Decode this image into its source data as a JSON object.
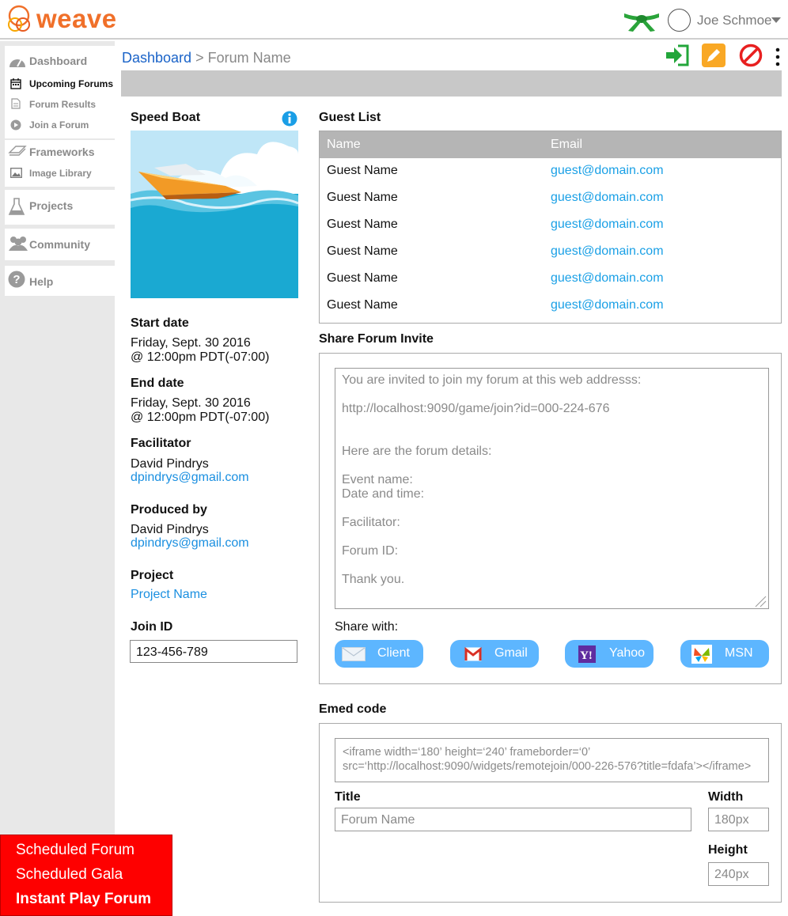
{
  "header": {
    "logo_text": "weave",
    "username": "Joe Schmoe"
  },
  "sidebar": {
    "dashboard": "Dashboard",
    "upcoming": "Upcoming Forums",
    "results": "Forum Results",
    "join": "Join a Forum",
    "frameworks": "Frameworks",
    "library": "Image Library",
    "projects": "Projects",
    "community": "Community",
    "help": "Help"
  },
  "breadcrumb": {
    "root": "Dashboard",
    "sep": " > ",
    "current": "Forum Name"
  },
  "forum": {
    "title": "Speed Boat",
    "start_label": "Start date",
    "start_date": "Friday, Sept. 30 2016",
    "start_time": "@ 12:00pm PDT(-07:00)",
    "end_label": "End date",
    "end_date": "Friday, Sept. 30 2016",
    "end_time": "@ 12:00pm PDT(-07:00)",
    "facilitator_label": "Facilitator",
    "facilitator_name": "David Pindrys",
    "facilitator_email": "dpindrys@gmail.com",
    "producer_label": "Produced by",
    "producer_name": "David Pindrys",
    "producer_email": "dpindrys@gmail.com",
    "project_label": "Project",
    "project_name": "Project Name",
    "join_label": "Join ID",
    "join_id": "123-456-789"
  },
  "guests": {
    "title": "Guest List",
    "col_name": "Name",
    "col_email": "Email",
    "rows": [
      {
        "name": "Guest Name",
        "email": "guest@domain.com"
      },
      {
        "name": "Guest Name",
        "email": "guest@domain.com"
      },
      {
        "name": "Guest Name",
        "email": "guest@domain.com"
      },
      {
        "name": "Guest Name",
        "email": "guest@domain.com"
      },
      {
        "name": "Guest Name",
        "email": "guest@domain.com"
      },
      {
        "name": "Guest Name",
        "email": "guest@domain.com"
      }
    ]
  },
  "share": {
    "title": "Share Forum Invite",
    "lines": [
      "You are invited to join my forum at this web addresss:",
      "http://localhost:9090/game/join?id=000-224-676",
      "Here are the forum details:",
      "Event name:",
      "Date and time:",
      "Facilitator:",
      "Forum ID:",
      "Thank you."
    ],
    "share_with": "Share with:",
    "buttons": [
      "Client",
      "Gmail",
      "Yahoo",
      "MSN"
    ]
  },
  "embed": {
    "title": "Emed code",
    "code": "<iframe width=‘180’ height=‘240’ frameborder=‘0’ src=‘http://localhost:9090/widgets/remotejoin/000-226-576?title=fdafa’></iframe>",
    "title_label": "Title",
    "title_value": "Forum Name",
    "width_label": "Width",
    "width_value": "180px",
    "height_label": "Height",
    "height_value": "240px"
  },
  "red_menu": [
    "Scheduled Forum",
    "Scheduled Gala",
    "Instant Play Forum"
  ],
  "colors": {
    "brand": "#f0702a",
    "link": "#1a63c8",
    "email": "#1aa0e6",
    "share_button": "#5db6ff",
    "menu_red": "#fe0000"
  }
}
